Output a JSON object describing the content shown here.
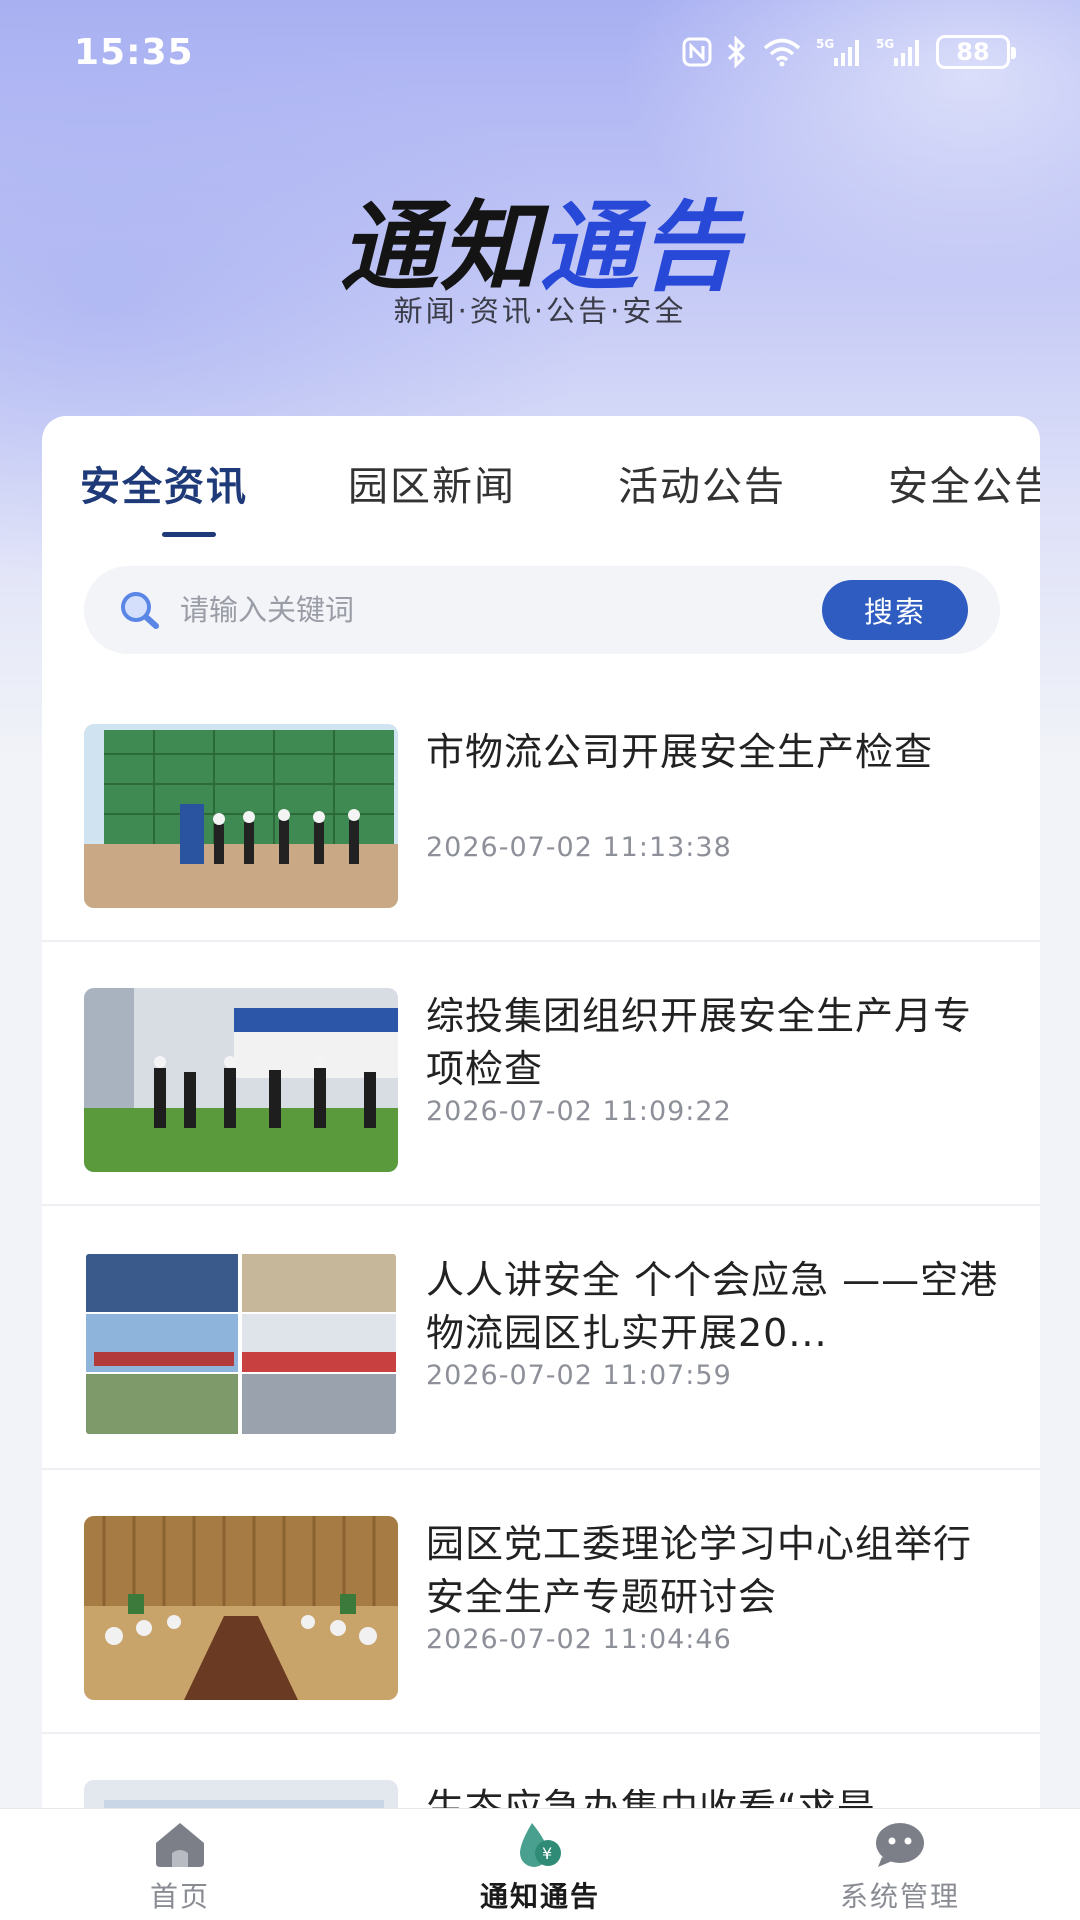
{
  "status_bar": {
    "time": "15:35",
    "network_label": "5G",
    "battery": "88",
    "icons": [
      "nfc-icon",
      "bluetooth-icon",
      "wifi-icon",
      "signal-5g-icon",
      "signal-5g-icon",
      "battery-icon"
    ]
  },
  "hero": {
    "title_part1": "通知",
    "title_part2": "通告",
    "subtitle": "新闻·资讯·公告·安全"
  },
  "tabs": [
    {
      "label": "安全资讯",
      "active": true
    },
    {
      "label": "园区新闻",
      "active": false
    },
    {
      "label": "活动公告",
      "active": false
    },
    {
      "label": "安全公告",
      "active": false
    }
  ],
  "search": {
    "placeholder": "请输入关键词",
    "button_label": "搜索"
  },
  "news": [
    {
      "title": "市物流公司开展安全生产检查",
      "date": "2026-07-02 11:13:38"
    },
    {
      "title": "综投集团组织开展安全生产月专项检查",
      "date": "2026-07-02 11:09:22"
    },
    {
      "title": "人人讲安全 个个会应急 ——空港物流园区扎实开展20...",
      "date": "2026-07-02 11:07:59"
    },
    {
      "title": "园区党工委理论学习中心组举行安全生产专题研讨会",
      "date": "2026-07-02 11:04:46"
    },
    {
      "title": "生态应急办集中收看“求是",
      "date": ""
    }
  ],
  "bottom_nav": [
    {
      "label": "首页",
      "icon": "home-icon",
      "active": false
    },
    {
      "label": "通知通告",
      "icon": "notice-icon",
      "active": true
    },
    {
      "label": "系统管理",
      "icon": "system-icon",
      "active": false
    }
  ],
  "colors": {
    "accent": "#1f3a78",
    "button": "#2f5cc0",
    "title_blue": "#2848d8",
    "nav_active_icon": "#3a9a8a"
  }
}
